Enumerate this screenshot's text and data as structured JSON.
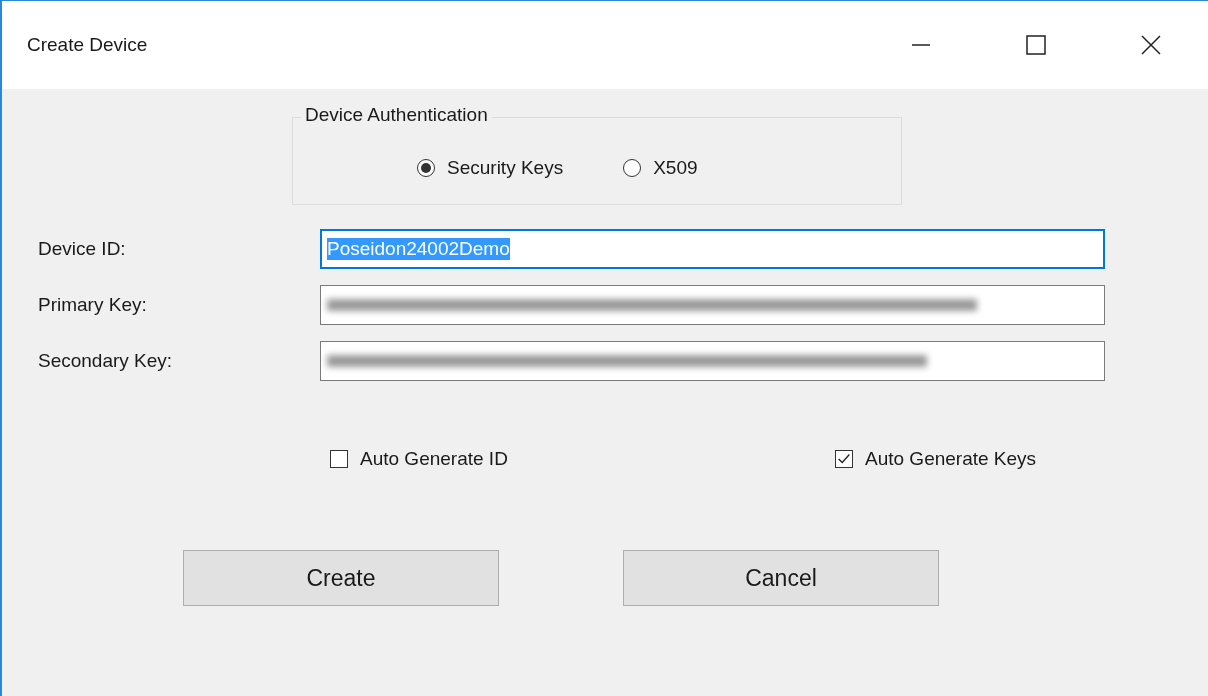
{
  "window": {
    "title": "Create Device"
  },
  "authentication": {
    "legend": "Device Authentication",
    "options": [
      {
        "label": "Security Keys",
        "selected": true
      },
      {
        "label": "X509",
        "selected": false
      }
    ]
  },
  "fields": [
    {
      "label": "Device ID:",
      "value": "Poseidon24002Demo",
      "focused": true,
      "text_selected": true,
      "blurred": false
    },
    {
      "label": "Primary Key:",
      "focused": false,
      "blurred": true
    },
    {
      "label": "Secondary Key:",
      "focused": false,
      "blurred": true
    }
  ],
  "checkboxes": [
    {
      "label": "Auto Generate ID",
      "checked": false
    },
    {
      "label": "Auto Generate Keys",
      "checked": true
    }
  ],
  "buttons": [
    "Create",
    "Cancel"
  ]
}
